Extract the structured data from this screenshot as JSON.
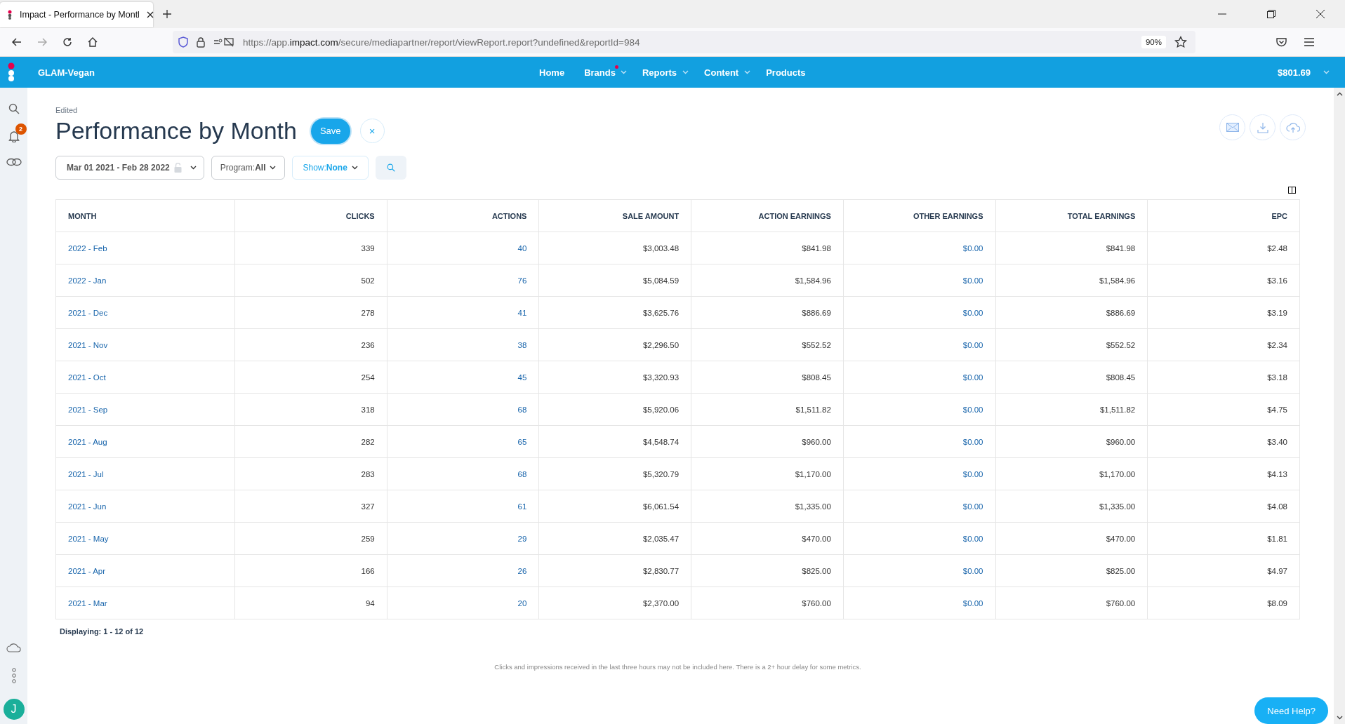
{
  "browser": {
    "tab_title": "Impact - Performance by Montl",
    "url_prefix": "https://app.",
    "url_domain": "impact.com",
    "url_path": "/secure/mediapartner/report/viewReport.report?undefined&reportId=984",
    "zoom": "90%"
  },
  "header": {
    "account": "GLAM-Vegan",
    "nav": [
      {
        "label": "Home",
        "dropdown": false,
        "dot": false
      },
      {
        "label": "Brands",
        "dropdown": true,
        "dot": true
      },
      {
        "label": "Reports",
        "dropdown": true,
        "dot": false
      },
      {
        "label": "Content",
        "dropdown": true,
        "dot": false
      },
      {
        "label": "Products",
        "dropdown": false,
        "dot": false
      }
    ],
    "balance": "$801.69"
  },
  "sidebar": {
    "notifications": "2",
    "avatar": "J"
  },
  "report": {
    "status": "Edited",
    "title": "Performance by Month",
    "save": "Save",
    "close": "×",
    "filters": [
      {
        "kind": "date",
        "label": "Mar 01 2021 - Feb 28 2022"
      },
      {
        "kind": "select",
        "label": "Program: ",
        "value": "All"
      },
      {
        "kind": "show",
        "label": "Show: ",
        "value": "None"
      }
    ]
  },
  "table": {
    "columns": [
      {
        "label": "MONTH",
        "kind": "label",
        "link": true
      },
      {
        "label": "CLICKS",
        "kind": "number",
        "link": false
      },
      {
        "label": "ACTIONS",
        "kind": "number",
        "link": true
      },
      {
        "label": "SALE AMOUNT",
        "kind": "number",
        "link": false
      },
      {
        "label": "ACTION EARNINGS",
        "kind": "number",
        "link": false
      },
      {
        "label": "OTHER EARNINGS",
        "kind": "number",
        "link": true
      },
      {
        "label": "TOTAL EARNINGS",
        "kind": "number",
        "link": false
      },
      {
        "label": "EPC",
        "kind": "number",
        "link": false
      }
    ],
    "rows": [
      [
        "2022 - Feb",
        "339",
        "40",
        "$3,003.48",
        "$841.98",
        "$0.00",
        "$841.98",
        "$2.48"
      ],
      [
        "2022 - Jan",
        "502",
        "76",
        "$5,084.59",
        "$1,584.96",
        "$0.00",
        "$1,584.96",
        "$3.16"
      ],
      [
        "2021 - Dec",
        "278",
        "41",
        "$3,625.76",
        "$886.69",
        "$0.00",
        "$886.69",
        "$3.19"
      ],
      [
        "2021 - Nov",
        "236",
        "38",
        "$2,296.50",
        "$552.52",
        "$0.00",
        "$552.52",
        "$2.34"
      ],
      [
        "2021 - Oct",
        "254",
        "45",
        "$3,320.93",
        "$808.45",
        "$0.00",
        "$808.45",
        "$3.18"
      ],
      [
        "2021 - Sep",
        "318",
        "68",
        "$5,920.06",
        "$1,511.82",
        "$0.00",
        "$1,511.82",
        "$4.75"
      ],
      [
        "2021 - Aug",
        "282",
        "65",
        "$4,548.74",
        "$960.00",
        "$0.00",
        "$960.00",
        "$3.40"
      ],
      [
        "2021 - Jul",
        "283",
        "68",
        "$5,320.79",
        "$1,170.00",
        "$0.00",
        "$1,170.00",
        "$4.13"
      ],
      [
        "2021 - Jun",
        "327",
        "61",
        "$6,061.54",
        "$1,335.00",
        "$0.00",
        "$1,335.00",
        "$4.08"
      ],
      [
        "2021 - May",
        "259",
        "29",
        "$2,035.47",
        "$470.00",
        "$0.00",
        "$470.00",
        "$1.81"
      ],
      [
        "2021 - Apr",
        "166",
        "26",
        "$2,830.77",
        "$825.00",
        "$0.00",
        "$825.00",
        "$4.97"
      ],
      [
        "2021 - Mar",
        "94",
        "20",
        "$2,370.00",
        "$760.00",
        "$0.00",
        "$760.00",
        "$8.09"
      ]
    ],
    "displaying": "Displaying: 1 - 12 of 12"
  },
  "footnote": "Clicks and impressions received in the last three hours may not be included here. There is a 2+ hour delay for some metrics.",
  "help": "Need Help?"
}
